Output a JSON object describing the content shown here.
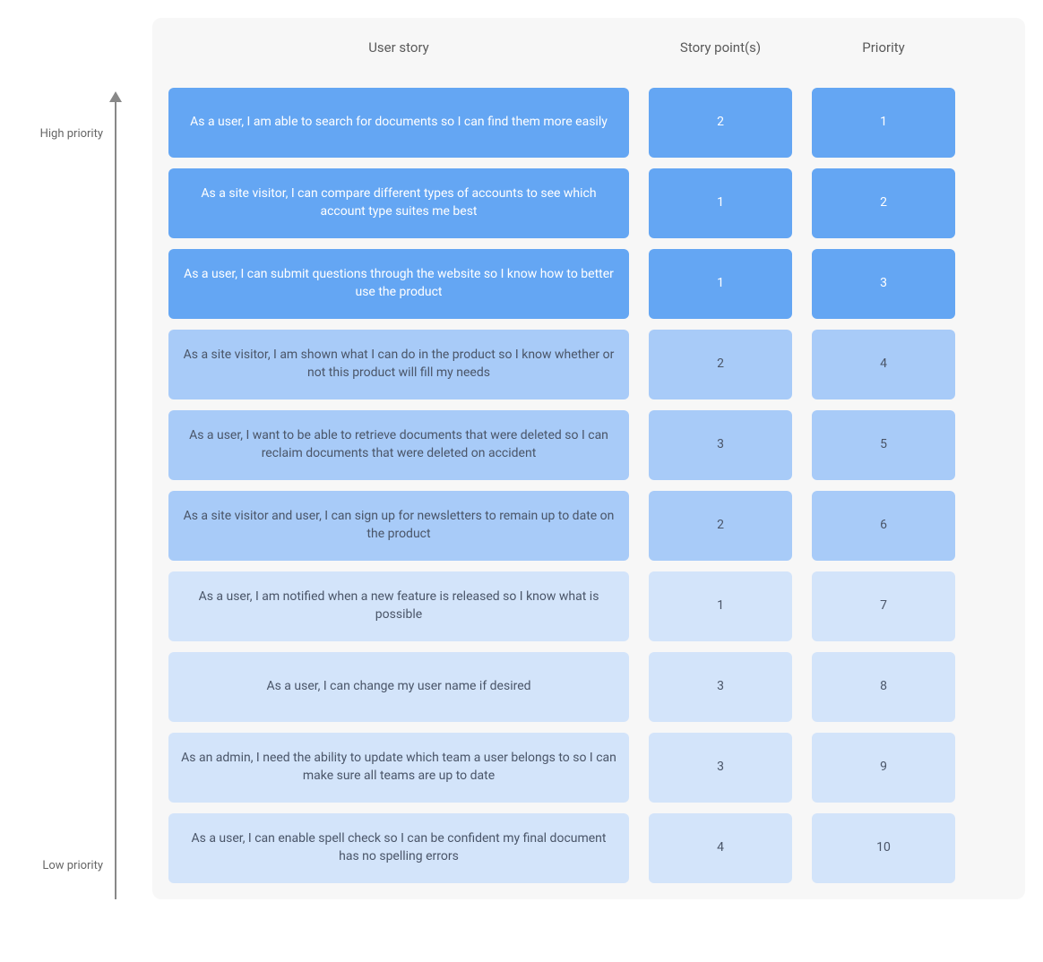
{
  "axis": {
    "high_label": "High priority",
    "low_label": "Low priority"
  },
  "headers": {
    "story": "User story",
    "points": "Story point(s)",
    "priority": "Priority"
  },
  "tiers": {
    "high": {
      "bg": "#64a6f3",
      "fg": "#ffffff"
    },
    "mid": {
      "bg": "#a8cbf8",
      "fg": "#4a5568"
    },
    "low": {
      "bg": "#d3e4fa",
      "fg": "#4a5568"
    }
  },
  "rows": [
    {
      "story": "As a user, I am able to search for documents so I can find them more easily",
      "points": "2",
      "priority": "1",
      "tier": "high"
    },
    {
      "story": "As a site visitor, I can compare different types of accounts to see which account type suites me best",
      "points": "1",
      "priority": "2",
      "tier": "high"
    },
    {
      "story": "As a user, I can submit questions through the website so I know how to better use the product",
      "points": "1",
      "priority": "3",
      "tier": "high"
    },
    {
      "story": "As a site visitor, I am shown what I can do in the product so I know whether or not this product will fill my needs",
      "points": "2",
      "priority": "4",
      "tier": "mid"
    },
    {
      "story": "As a user, I want to be able to retrieve documents that were deleted so I can reclaim documents that were deleted on accident",
      "points": "3",
      "priority": "5",
      "tier": "mid"
    },
    {
      "story": "As a site visitor and user, I can sign up for newsletters to remain up to date on the product",
      "points": "2",
      "priority": "6",
      "tier": "mid"
    },
    {
      "story": "As a user, I am notified when a new feature is released so I know what is possible",
      "points": "1",
      "priority": "7",
      "tier": "low"
    },
    {
      "story": "As a user, I can change my user name if desired",
      "points": "3",
      "priority": "8",
      "tier": "low"
    },
    {
      "story": "As an admin, I need the ability to update which team a user belongs to so I can make sure all teams are up to date",
      "points": "3",
      "priority": "9",
      "tier": "low"
    },
    {
      "story": "As a user, I can enable spell check so I can be confident my final document has no spelling errors",
      "points": "4",
      "priority": "10",
      "tier": "low"
    }
  ]
}
